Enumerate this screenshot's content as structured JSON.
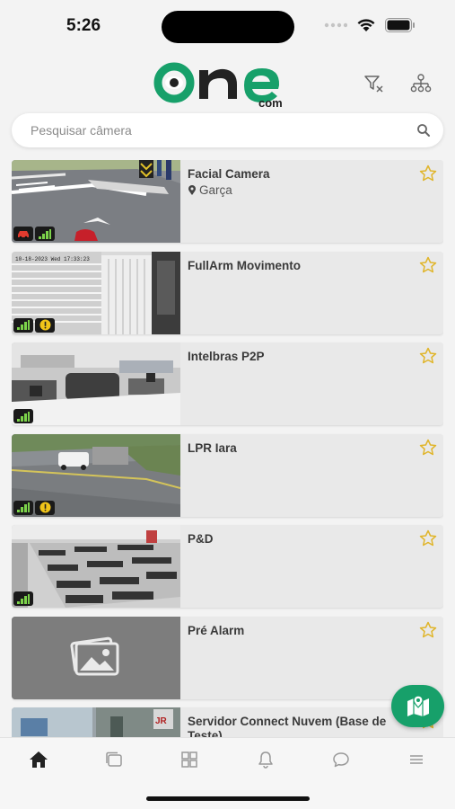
{
  "status": {
    "time": "5:26"
  },
  "brand": {
    "logo_text": "one",
    "logo_sub": "com",
    "primary_color": "#17a06a",
    "star_color": "#e0b52a"
  },
  "search": {
    "placeholder": "Pesquisar câmera"
  },
  "cameras": [
    {
      "name": "Facial Camera",
      "location": "Garça",
      "badges": [
        "car-icon",
        "signal-icon"
      ],
      "thumb": "road-scene"
    },
    {
      "name": "FullArm Movimento",
      "location": "",
      "badges": [
        "signal-icon",
        "warning-icon"
      ],
      "thumb": "interior-blinds",
      "overlay_text": "10-18-2023 Wed 17:33:23"
    },
    {
      "name": "Intelbras P2P",
      "location": "",
      "badges": [
        "signal-icon"
      ],
      "thumb": "office-scene"
    },
    {
      "name": "LPR Iara",
      "location": "",
      "badges": [
        "signal-icon",
        "warning-icon"
      ],
      "thumb": "street-scene"
    },
    {
      "name": "P&D",
      "location": "",
      "badges": [
        "signal-icon"
      ],
      "thumb": "lab-scene"
    },
    {
      "name": "Pré Alarm",
      "location": "",
      "badges": [],
      "thumb": "placeholder-image"
    },
    {
      "name": "Servidor Connect Nuvem (Base de Teste)",
      "location": "",
      "badges": [],
      "thumb": "server-scene"
    }
  ],
  "tabs": [
    "home-icon",
    "tabs-icon",
    "grid-icon",
    "bell-icon",
    "chat-icon",
    "menu-icon"
  ]
}
